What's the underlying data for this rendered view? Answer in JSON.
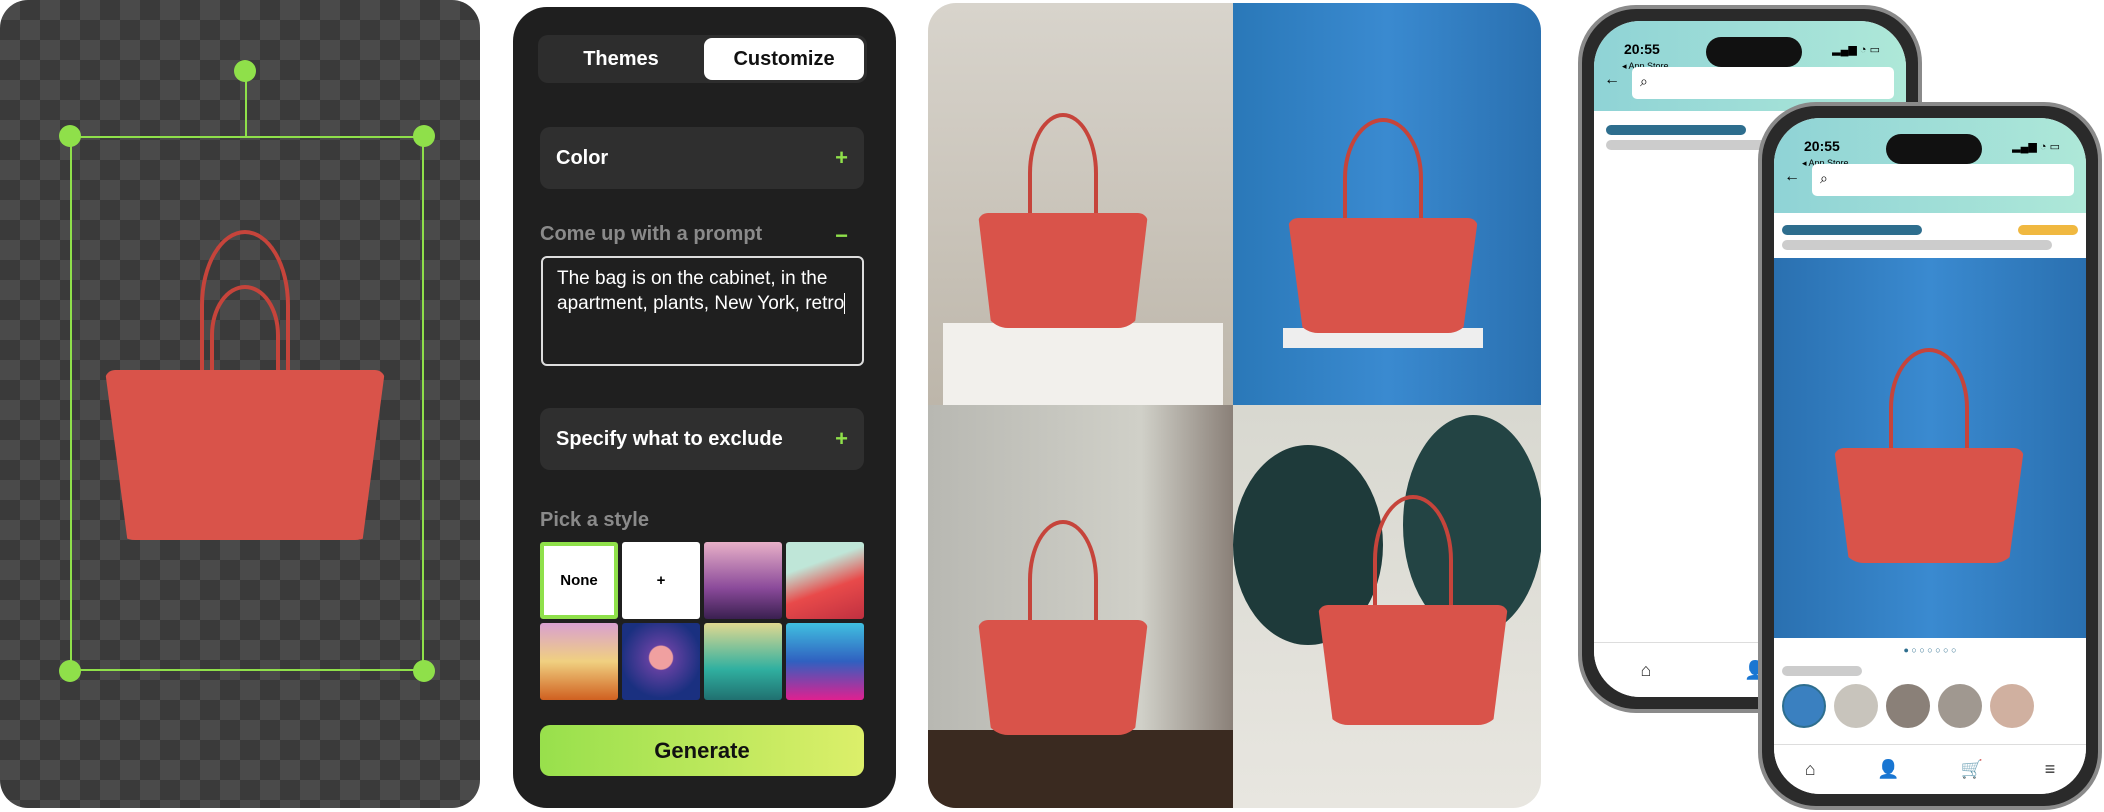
{
  "editor": {
    "tabs": [
      {
        "label": "Themes"
      },
      {
        "label": "Customize"
      }
    ],
    "active_tab": "Customize",
    "color_label": "Color",
    "prompt_label": "Come up with a prompt",
    "prompt_value": "The bag is on the cabinet, in the apartment, plants, New York, retro",
    "exclude_label": "Specify what to exclude",
    "style_label": "Pick a style",
    "styles": [
      {
        "label": "None",
        "selected": true
      },
      {
        "label": "+"
      },
      {
        "label": ""
      },
      {
        "label": ""
      },
      {
        "label": ""
      },
      {
        "label": ""
      },
      {
        "label": ""
      },
      {
        "label": ""
      }
    ],
    "generate_label": "Generate",
    "plus": "+",
    "minus": "−",
    "accent": "#8fe04a"
  },
  "phones": [
    {
      "time": "20:55",
      "back_app": "◂ App Store"
    },
    {
      "time": "20:55",
      "back_app": "◂ App Store"
    }
  ],
  "icons": {
    "search": "⌕",
    "back": "←",
    "home": "⌂",
    "user": "👤",
    "cart": "🛒",
    "menu": "≡"
  }
}
